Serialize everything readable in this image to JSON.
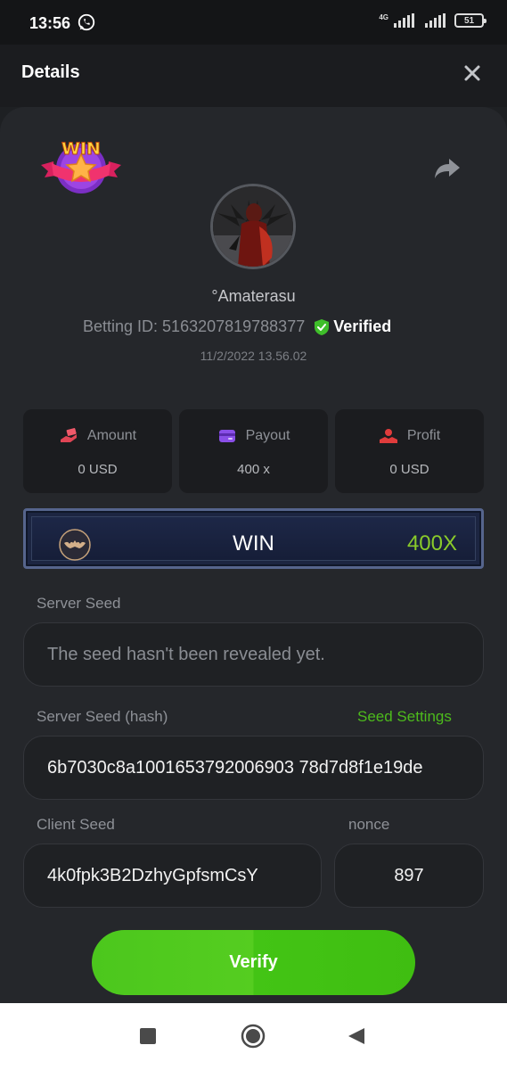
{
  "status_bar": {
    "time": "13:56",
    "network": "4G",
    "battery": "51"
  },
  "header": {
    "title": "Details"
  },
  "bet": {
    "username": "°Amaterasu",
    "betting_id": "Betting ID: 5163207819788377",
    "verified_label": "Verified",
    "timestamp": "11/2/2022 13.56.02"
  },
  "stats": [
    {
      "label": "Amount",
      "value": "0 USD",
      "icon": "money-hand-icon",
      "color": "#e04555"
    },
    {
      "label": "Payout",
      "value": "400 x",
      "icon": "card-icon",
      "color": "#8a4fe8"
    },
    {
      "label": "Profit",
      "value": "0 USD",
      "icon": "coins-hand-icon",
      "color": "#e03c3c"
    }
  ],
  "result": {
    "label": "WIN",
    "multiplier": "400X",
    "multiplier_color": "#8acb2a"
  },
  "server_seed": {
    "label": "Server Seed",
    "value": "The seed hasn't been revealed yet."
  },
  "server_seed_hash": {
    "label": "Server Seed (hash)",
    "link": "Seed Settings",
    "value": "6b7030c8a1001653792006903 78d7d8f1e19de"
  },
  "client_seed": {
    "label": "Client Seed",
    "value": "4k0fpk3B2DzhyGpfsmCsY"
  },
  "nonce": {
    "label": "nonce",
    "value": "897"
  },
  "verify_button": {
    "label": "Verify"
  },
  "badge": {
    "text": "WIN"
  },
  "colors": {
    "accent_green": "#4dbb1c",
    "card_bg": "#25272b"
  }
}
